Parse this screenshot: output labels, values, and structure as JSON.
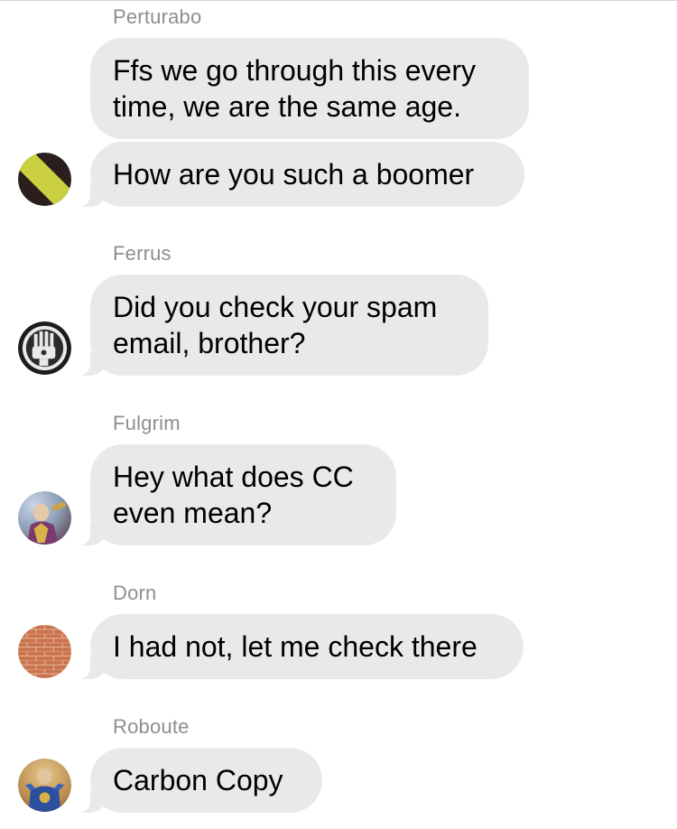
{
  "conversation": {
    "messages": [
      {
        "sender": "Perturabo",
        "bubbles": [
          "Ffs we go through this every",
          "time, we are the same age.",
          "How are you such a boomer"
        ],
        "avatar": "striped-hazard-avatar-icon"
      },
      {
        "sender": "Ferrus",
        "bubbles": [
          "Did you check your spam",
          "email, brother?"
        ],
        "avatar": "iron-hand-cog-avatar-icon"
      },
      {
        "sender": "Fulgrim",
        "bubbles": [
          "Hey what does CC",
          "even mean?"
        ],
        "avatar": "armored-figure-avatar-icon"
      },
      {
        "sender": "Dorn",
        "bubbles": [
          "I had not, let me check there"
        ],
        "avatar": "brick-wall-avatar-icon"
      },
      {
        "sender": "Roboute",
        "bubbles": [
          "Carbon Copy"
        ],
        "avatar": "blue-armored-figure-avatar-icon"
      }
    ]
  },
  "colors": {
    "bubble_bg": "#e9e9eb",
    "sender_text": "#8e8e93",
    "message_text": "#000000",
    "background": "#ffffff"
  }
}
